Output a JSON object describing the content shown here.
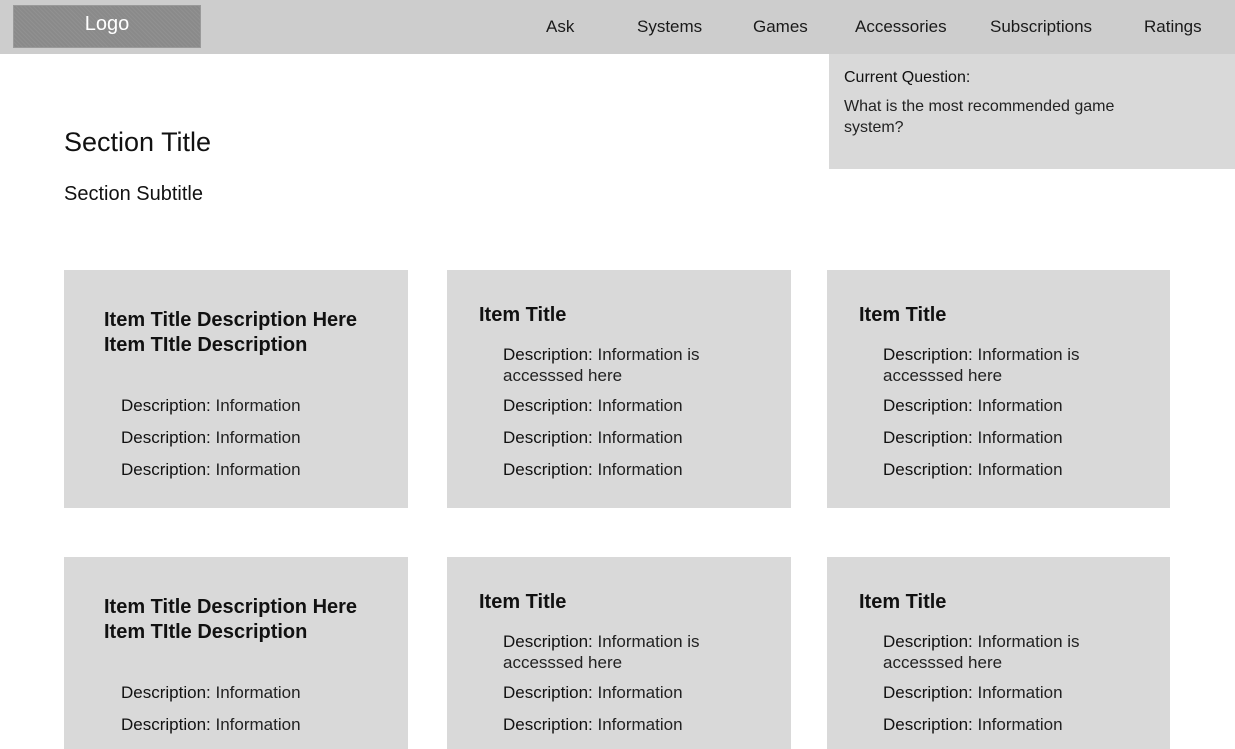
{
  "header": {
    "logo": "Logo",
    "nav": [
      "Ask",
      "Systems",
      "Games",
      "Accessories",
      "Subscriptions",
      "Ratings"
    ]
  },
  "question": {
    "label": "Current Question:",
    "text": "What is the most recommended game system?"
  },
  "section": {
    "title": "Section Title",
    "subtitle": "Section Subtitle"
  },
  "cards": [
    {
      "title": "Item Title Description Here Item TItle Description",
      "rows": [
        {
          "label": "Description:",
          "value": " Information"
        },
        {
          "label": "Description:",
          "value": " Information"
        },
        {
          "label": "Description:",
          "value": " Information"
        }
      ]
    },
    {
      "title": "Item Title",
      "rows": [
        {
          "label": "Description:",
          "value": " Information is accesssed here"
        },
        {
          "label": "Description:",
          "value": " Information"
        },
        {
          "label": "Description:",
          "value": " Information"
        },
        {
          "label": "Description:",
          "value": " Information"
        }
      ]
    },
    {
      "title": "Item Title",
      "rows": [
        {
          "label": "Description:",
          "value": " Information is accesssed here"
        },
        {
          "label": "Description:",
          "value": " Information"
        },
        {
          "label": "Description:",
          "value": " Information"
        },
        {
          "label": "Description:",
          "value": " Information"
        }
      ]
    },
    {
      "title": "Item Title Description Here Item TItle Description",
      "rows": [
        {
          "label": "Description:",
          "value": " Information"
        },
        {
          "label": "Description:",
          "value": " Information"
        }
      ]
    },
    {
      "title": "Item Title",
      "rows": [
        {
          "label": "Description:",
          "value": " Information is accesssed here"
        },
        {
          "label": "Description:",
          "value": " Information"
        },
        {
          "label": "Description:",
          "value": " Information"
        }
      ]
    },
    {
      "title": "Item Title",
      "rows": [
        {
          "label": "Description:",
          "value": " Information is accesssed here"
        },
        {
          "label": "Description:",
          "value": " Information"
        },
        {
          "label": "Description:",
          "value": " Information"
        }
      ]
    }
  ]
}
